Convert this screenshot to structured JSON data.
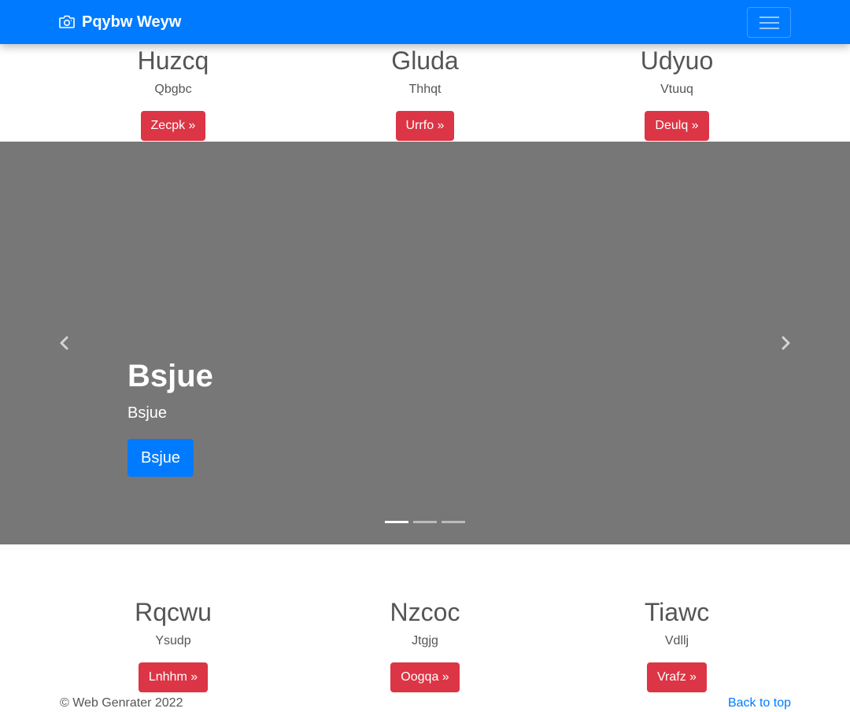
{
  "navbar": {
    "brand": "Pqybw Weyw",
    "brand_icon": "camera-icon",
    "toggler_icon": "hamburger-icon",
    "color": "#007bff"
  },
  "features_top": [
    {
      "title": "Huzcq",
      "subtitle": "Qbgbc",
      "button": "Zecpk »"
    },
    {
      "title": "Gluda",
      "subtitle": "Thhqt",
      "button": "Urrfo »"
    },
    {
      "title": "Udyuo",
      "subtitle": "Vtuuq",
      "button": "Deulq »"
    }
  ],
  "carousel": {
    "heading": "Bsjue",
    "text": "Bsjue",
    "button": "Bsjue",
    "slide_count": 3,
    "active_slide": 1,
    "background": "#777777"
  },
  "features_bottom": [
    {
      "title": "Rqcwu",
      "subtitle": "Ysudp",
      "button": "Lnhhm »"
    },
    {
      "title": "Nzcoc",
      "subtitle": "Jtgjg",
      "button": "Oogqa »"
    },
    {
      "title": "Tiawc",
      "subtitle": "Vdllj",
      "button": "Vrafz »"
    }
  ],
  "footer": {
    "copyright": "© Web Genrater 2022",
    "back_to_top": "Back to top"
  },
  "colors": {
    "primary": "#007bff",
    "danger": "#dc3545"
  }
}
